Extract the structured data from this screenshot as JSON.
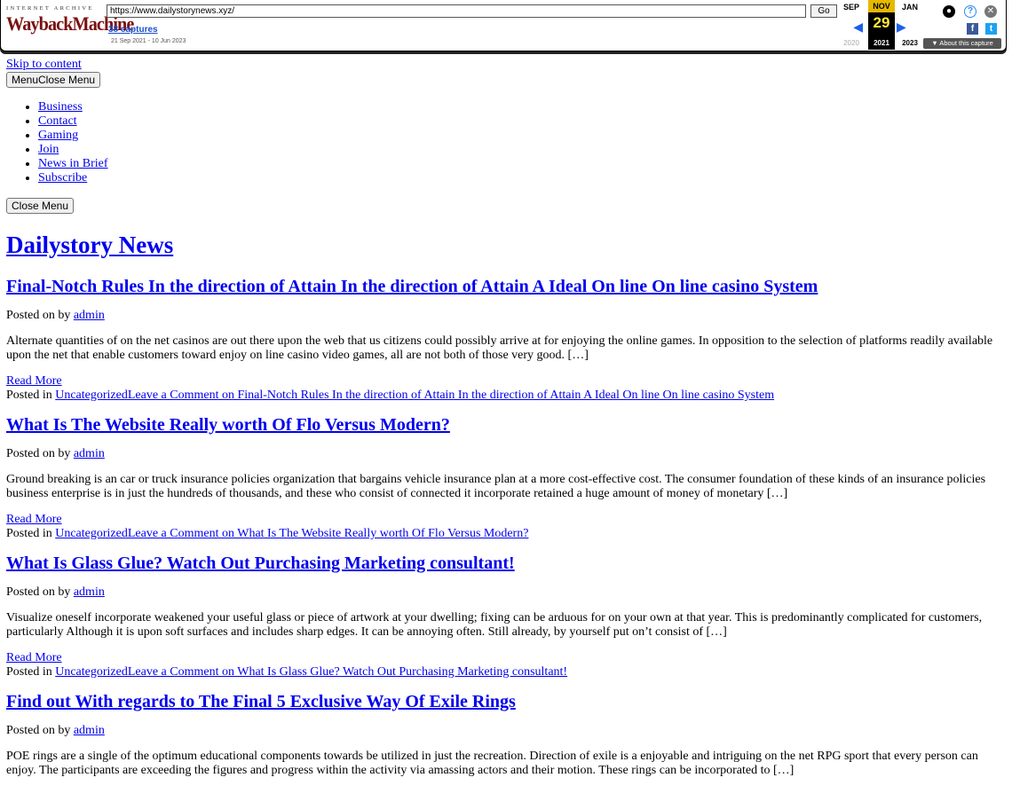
{
  "wayback": {
    "logo_top": "INTERNET ARCHIVE",
    "logo_main": "WaybackMachine",
    "url": "https://www.dailystorynews.xyz/",
    "go_label": "Go",
    "captures": "38 captures",
    "range": "21 Sep 2021 - 10 Jun 2023",
    "calendar": {
      "prev": {
        "month": "SEP",
        "year": "2020"
      },
      "current": {
        "month": "NOV",
        "day": "29",
        "year": "2021"
      },
      "next": {
        "month": "JAN",
        "year": "2023"
      }
    },
    "about_label": "▼ About this capture"
  },
  "page": {
    "skip_link": "Skip to content",
    "menu_button": "MenuClose Menu",
    "nav": [
      "Business",
      "Contact",
      "Gaming",
      "Join",
      "News in Brief",
      "Subscribe"
    ],
    "close_menu": "Close Menu",
    "site_title": "Dailystory News"
  },
  "posts": [
    {
      "title": "Final-Notch Rules In the direction of Attain In the direction of Attain A Ideal On line On line casino System",
      "posted_prefix": "Posted on by ",
      "author": "admin",
      "excerpt": "Alternate quantities of on the net casinos are out there upon the web that us citizens could possibly arrive at for enjoying the online games. In opposition to the selection of platforms readily available upon the net that enable customers toward enjoy on line casino video games, all are not both of those very good. […]",
      "read_more": "Read More",
      "posted_in": "Posted in ",
      "category_comment": "UncategorizedLeave a Comment on Final-Notch Rules In the direction of Attain In the direction of Attain A Ideal On line On line casino System"
    },
    {
      "title": "What Is The Website Really worth Of Flo Versus Modern?",
      "posted_prefix": "Posted on by ",
      "author": "admin",
      "excerpt": "Ground breaking is an car or truck insurance policies organization that bargains vehicle insurance plan at a more cost-effective cost. The consumer foundation of these kinds of an insurance policies business enterprise is in just the hundreds of thousands, and these who consist of connected it incorporate retained a huge amount of money of monetary […]",
      "read_more": "Read More",
      "posted_in": "Posted in ",
      "category_comment": "UncategorizedLeave a Comment on What Is The Website Really worth Of Flo Versus Modern?"
    },
    {
      "title": "What Is Glass Glue? Watch Out Purchasing Marketing consultant!",
      "posted_prefix": "Posted on by ",
      "author": "admin",
      "excerpt": "Visualize oneself incorporate weakened your useful glass or piece of artwork at your dwelling; fixing can be arduous for on your own at that year. This is predominantly complicated for customers, particularly Although it is upon soft surfaces and includes sharp edges. It can be annoying often. Still already, by yourself put on’t consist of […]",
      "read_more": "Read More",
      "posted_in": "Posted in ",
      "category_comment": "UncategorizedLeave a Comment on What Is Glass Glue? Watch Out Purchasing Marketing consultant!"
    },
    {
      "title": "Find out With regards to The Final 5 Exclusive Way Of Exile Rings",
      "posted_prefix": "Posted on by ",
      "author": "admin",
      "excerpt": "POE rings are a single of the optimum educational components towards be utilized in just the recreation. Direction of exile is a enjoyable and intriguing on the net RPG sport that every person can enjoy. The participants are exceeding the figures and progress within the activity via amassing actors and their motion. These rings can be incorporated to […]"
    }
  ]
}
